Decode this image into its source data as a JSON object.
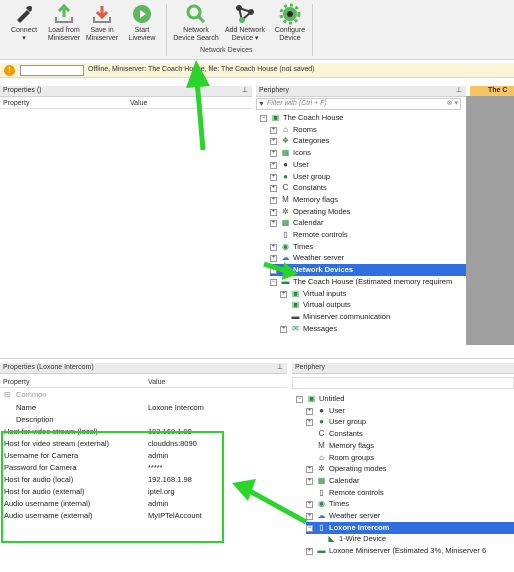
{
  "ribbon": {
    "buttons": [
      {
        "label": "Connect",
        "sub": "▾",
        "icon": "connect-icon"
      },
      {
        "label": "Load from",
        "sub": "Miniserver",
        "icon": "load-icon"
      },
      {
        "label": "Save in",
        "sub": "Miniserver",
        "icon": "save-icon"
      },
      {
        "label": "Start",
        "sub": "Liveview",
        "icon": "play-icon"
      },
      {
        "label": "Network",
        "sub": "Device Search",
        "icon": "search-icon"
      },
      {
        "label": "Add Network",
        "sub": "Device ▾",
        "icon": "network-icon"
      },
      {
        "label": "Configure",
        "sub": "Device",
        "icon": "gear-icon"
      }
    ],
    "group_label": "Network Devices"
  },
  "status": {
    "text": "Offline, Miniserver: The Coach House, file: The Coach House (not saved)"
  },
  "top_panel": {
    "properties_title": "Properties ()",
    "property_col": "Property",
    "value_col": "Value",
    "periphery_title": "Periphery",
    "filter_placeholder": "Filter with (Ctrl + F)",
    "tab_label": "The C",
    "tree": [
      {
        "label": "The Coach House",
        "level": 0,
        "icon": "project-icon",
        "expander": "minus"
      },
      {
        "label": "Rooms",
        "level": 1,
        "icon": "house-icon",
        "expander": "plus"
      },
      {
        "label": "Categories",
        "level": 1,
        "icon": "categories-icon",
        "expander": "plus"
      },
      {
        "label": "Icons",
        "level": 1,
        "icon": "image-icon",
        "expander": "plus"
      },
      {
        "label": "User",
        "level": 1,
        "icon": "user-icon",
        "expander": "plus"
      },
      {
        "label": "User group",
        "level": 1,
        "icon": "user-group-icon",
        "expander": "plus"
      },
      {
        "label": "Constants",
        "level": 1,
        "icon": "constant-icon",
        "expander": "plus"
      },
      {
        "label": "Memory flags",
        "level": 1,
        "icon": "memory-flag-icon",
        "expander": "plus"
      },
      {
        "label": "Operating Modes",
        "level": 1,
        "icon": "gear-icon",
        "expander": "plus"
      },
      {
        "label": "Calendar",
        "level": 1,
        "icon": "calendar-icon",
        "expander": "plus"
      },
      {
        "label": "Remote controls",
        "level": 1,
        "icon": "remote-icon",
        "expander": "none"
      },
      {
        "label": "Times",
        "level": 1,
        "icon": "clock-icon",
        "expander": "plus"
      },
      {
        "label": "Weather server",
        "level": 1,
        "icon": "weather-icon",
        "expander": "plus"
      },
      {
        "label": "Network Devices",
        "level": 1,
        "icon": "network-icon",
        "expander": "plus",
        "selected": true
      },
      {
        "label": "The Coach House (Estimated memory requirem",
        "level": 1,
        "icon": "miniserver-icon",
        "expander": "minus"
      },
      {
        "label": "Virtual inputs",
        "level": 2,
        "icon": "virtual-input-icon",
        "expander": "plus"
      },
      {
        "label": "Virtual outputs",
        "level": 2,
        "icon": "virtual-output-icon",
        "expander": "none"
      },
      {
        "label": "Miniserver communication",
        "level": 2,
        "icon": "communication-icon",
        "expander": "none"
      },
      {
        "label": "Messages",
        "level": 2,
        "icon": "messages-icon",
        "expander": "plus"
      }
    ]
  },
  "bottom_panel": {
    "properties_title": "Properties (Loxone Intercom)",
    "property_col": "Property",
    "value_col": "Value",
    "section": "Common",
    "rows": [
      {
        "name": "Name",
        "value": "Loxone Intercom"
      },
      {
        "name": "Description",
        "value": ""
      },
      {
        "name": "Host for video stream (local)",
        "value": "192.168.1.99"
      },
      {
        "name": "Host for video stream (external)",
        "value": "clouddns:8090"
      },
      {
        "name": "Username for Camera",
        "value": "admin"
      },
      {
        "name": "Password for Camera",
        "value": "*****"
      },
      {
        "name": "Host for audio (local)",
        "value": "192.168.1.98"
      },
      {
        "name": "Host for audio (external)",
        "value": "iptel.org"
      },
      {
        "name": "Audio username (internal)",
        "value": "admin"
      },
      {
        "name": "Audio username (external)",
        "value": "MyIPTelAccount"
      }
    ],
    "periphery_title": "Periphery",
    "tree": [
      {
        "label": "Untitled",
        "level": 0,
        "icon": "project-icon",
        "expander": "minus"
      },
      {
        "label": "User",
        "level": 1,
        "icon": "user-icon",
        "expander": "plus"
      },
      {
        "label": "User group",
        "level": 1,
        "icon": "user-group-icon",
        "expander": "plus"
      },
      {
        "label": "Constants",
        "level": 1,
        "icon": "constant-icon",
        "expander": "none"
      },
      {
        "label": "Memory flags",
        "level": 1,
        "icon": "memory-flag-icon",
        "expander": "none"
      },
      {
        "label": "Room groups",
        "level": 1,
        "icon": "house-icon",
        "expander": "none"
      },
      {
        "label": "Operating modes",
        "level": 1,
        "icon": "gear-icon",
        "expander": "plus"
      },
      {
        "label": "Calendar",
        "level": 1,
        "icon": "calendar-icon",
        "expander": "plus"
      },
      {
        "label": "Remote controls",
        "level": 1,
        "icon": "remote-icon",
        "expander": "none"
      },
      {
        "label": "Times",
        "level": 1,
        "icon": "clock-icon",
        "expander": "plus"
      },
      {
        "label": "Weather server",
        "level": 1,
        "icon": "weather-icon",
        "expander": "plus"
      },
      {
        "label": "Loxone Intercom",
        "level": 1,
        "icon": "intercom-icon",
        "expander": "minus",
        "selected": true
      },
      {
        "label": "1-Wire Device",
        "level": 2,
        "icon": "onewire-icon",
        "expander": "none"
      },
      {
        "label": "Loxone Miniserver (Estimated 3%, Miniserver 6",
        "level": 1,
        "icon": "miniserver-icon",
        "expander": "plus"
      }
    ]
  },
  "colors": {
    "highlight": "#2bd42b",
    "selection": "#2f6fe0",
    "status_bg": "#fbf5d8",
    "tab": "#f7c463"
  }
}
